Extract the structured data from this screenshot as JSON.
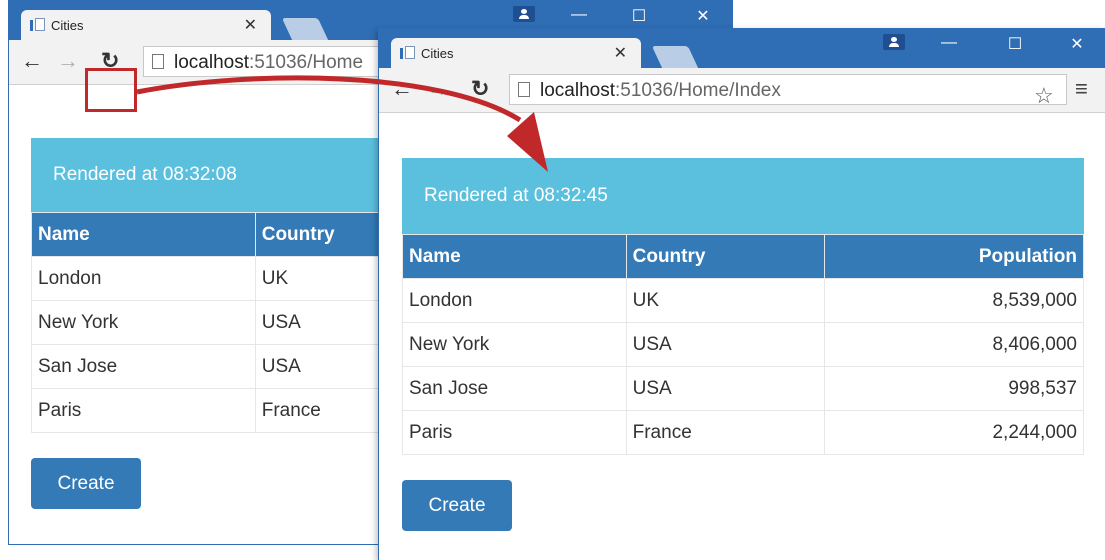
{
  "back_window": {
    "tab_title": "Cities",
    "url_host": "localhost",
    "url_path": ":51036/Home",
    "rendered_text": "Rendered at 08:32:08",
    "columns": [
      "Name",
      "Country"
    ],
    "rows": [
      [
        "London",
        "UK"
      ],
      [
        "New York",
        "USA"
      ],
      [
        "San Jose",
        "USA"
      ],
      [
        "Paris",
        "France"
      ]
    ],
    "create_label": "Create"
  },
  "front_window": {
    "tab_title": "Cities",
    "url_host": "localhost",
    "url_path": ":51036/Home/Index",
    "rendered_text": "Rendered at 08:32:45",
    "columns": [
      "Name",
      "Country",
      "Population"
    ],
    "rows": [
      [
        "London",
        "UK",
        "8,539,000"
      ],
      [
        "New York",
        "USA",
        "8,406,000"
      ],
      [
        "San Jose",
        "USA",
        "998,537"
      ],
      [
        "Paris",
        "France",
        "2,244,000"
      ]
    ],
    "create_label": "Create"
  },
  "colors": {
    "titlebar": "#2f6db5",
    "panel": "#5bc0de",
    "header": "#337ab7",
    "annotation": "#c0282a"
  }
}
